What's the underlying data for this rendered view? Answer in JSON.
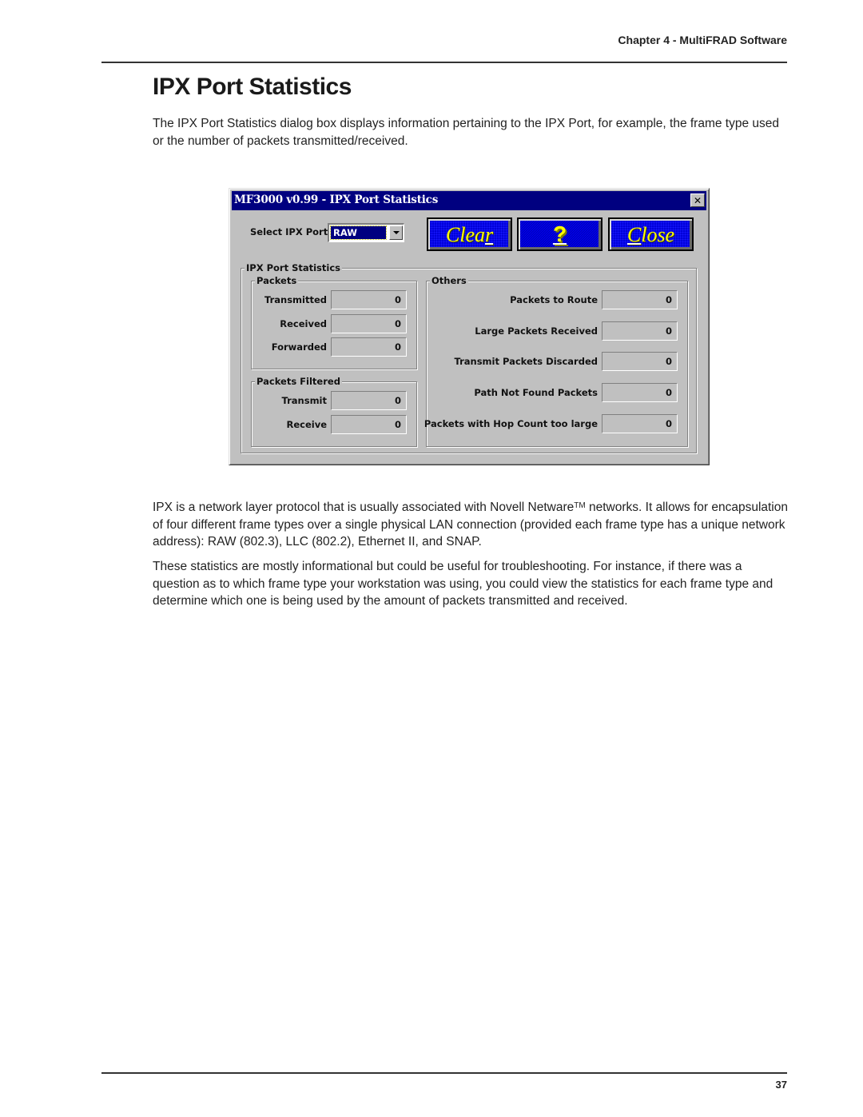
{
  "page": {
    "running_head": "Chapter 4 - MultiFRAD Software",
    "title": "IPX Port Statistics",
    "intro": "The IPX Port Statistics dialog box displays information pertaining to the IPX Port, for example, the frame type used or the number of packets transmitted/received.",
    "para2_before_tm": "IPX is a network layer protocol that is usually associated with Novell Netware",
    "para2_tm": "TM",
    "para2_after_tm": " networks.  It allows for encapsulation of four different frame types over a single physical LAN connection (provided each frame type has a unique network address):  RAW (802.3), LLC (802.2), Ethernet II, and SNAP.",
    "para3": "These statistics are mostly informational but could be useful for troubleshooting.  For instance, if there was a question as to which frame type your workstation was using, you could view the statistics for each frame type and determine which one is being used by the amount of packets transmitted and received.",
    "page_number": "37"
  },
  "dialog": {
    "title": "MF3000 v0.99 - IPX Port Statistics",
    "close_glyph": "✕",
    "select_label": "Select IPX Port",
    "selected_port": "RAW",
    "buttons": {
      "clear_a": "Clea",
      "clear_u": "r",
      "help": "?",
      "close_u": "C",
      "close_b": "lose"
    },
    "group_title": "IPX Port Statistics",
    "packets": {
      "title": "Packets",
      "rows": [
        {
          "label": "Transmitted",
          "value": "0"
        },
        {
          "label": "Received",
          "value": "0"
        },
        {
          "label": "Forwarded",
          "value": "0"
        }
      ]
    },
    "packets_filtered": {
      "title": "Packets Filtered",
      "rows": [
        {
          "label": "Transmit",
          "value": "0"
        },
        {
          "label": "Receive",
          "value": "0"
        }
      ]
    },
    "others": {
      "title": "Others",
      "rows": [
        {
          "label": "Packets to Route",
          "value": "0"
        },
        {
          "label": "Large Packets Received",
          "value": "0"
        },
        {
          "label": "Transmit Packets Discarded",
          "value": "0"
        },
        {
          "label": "Path Not Found Packets",
          "value": "0"
        },
        {
          "label": "Packets with Hop Count too large",
          "value": "0"
        }
      ]
    }
  }
}
